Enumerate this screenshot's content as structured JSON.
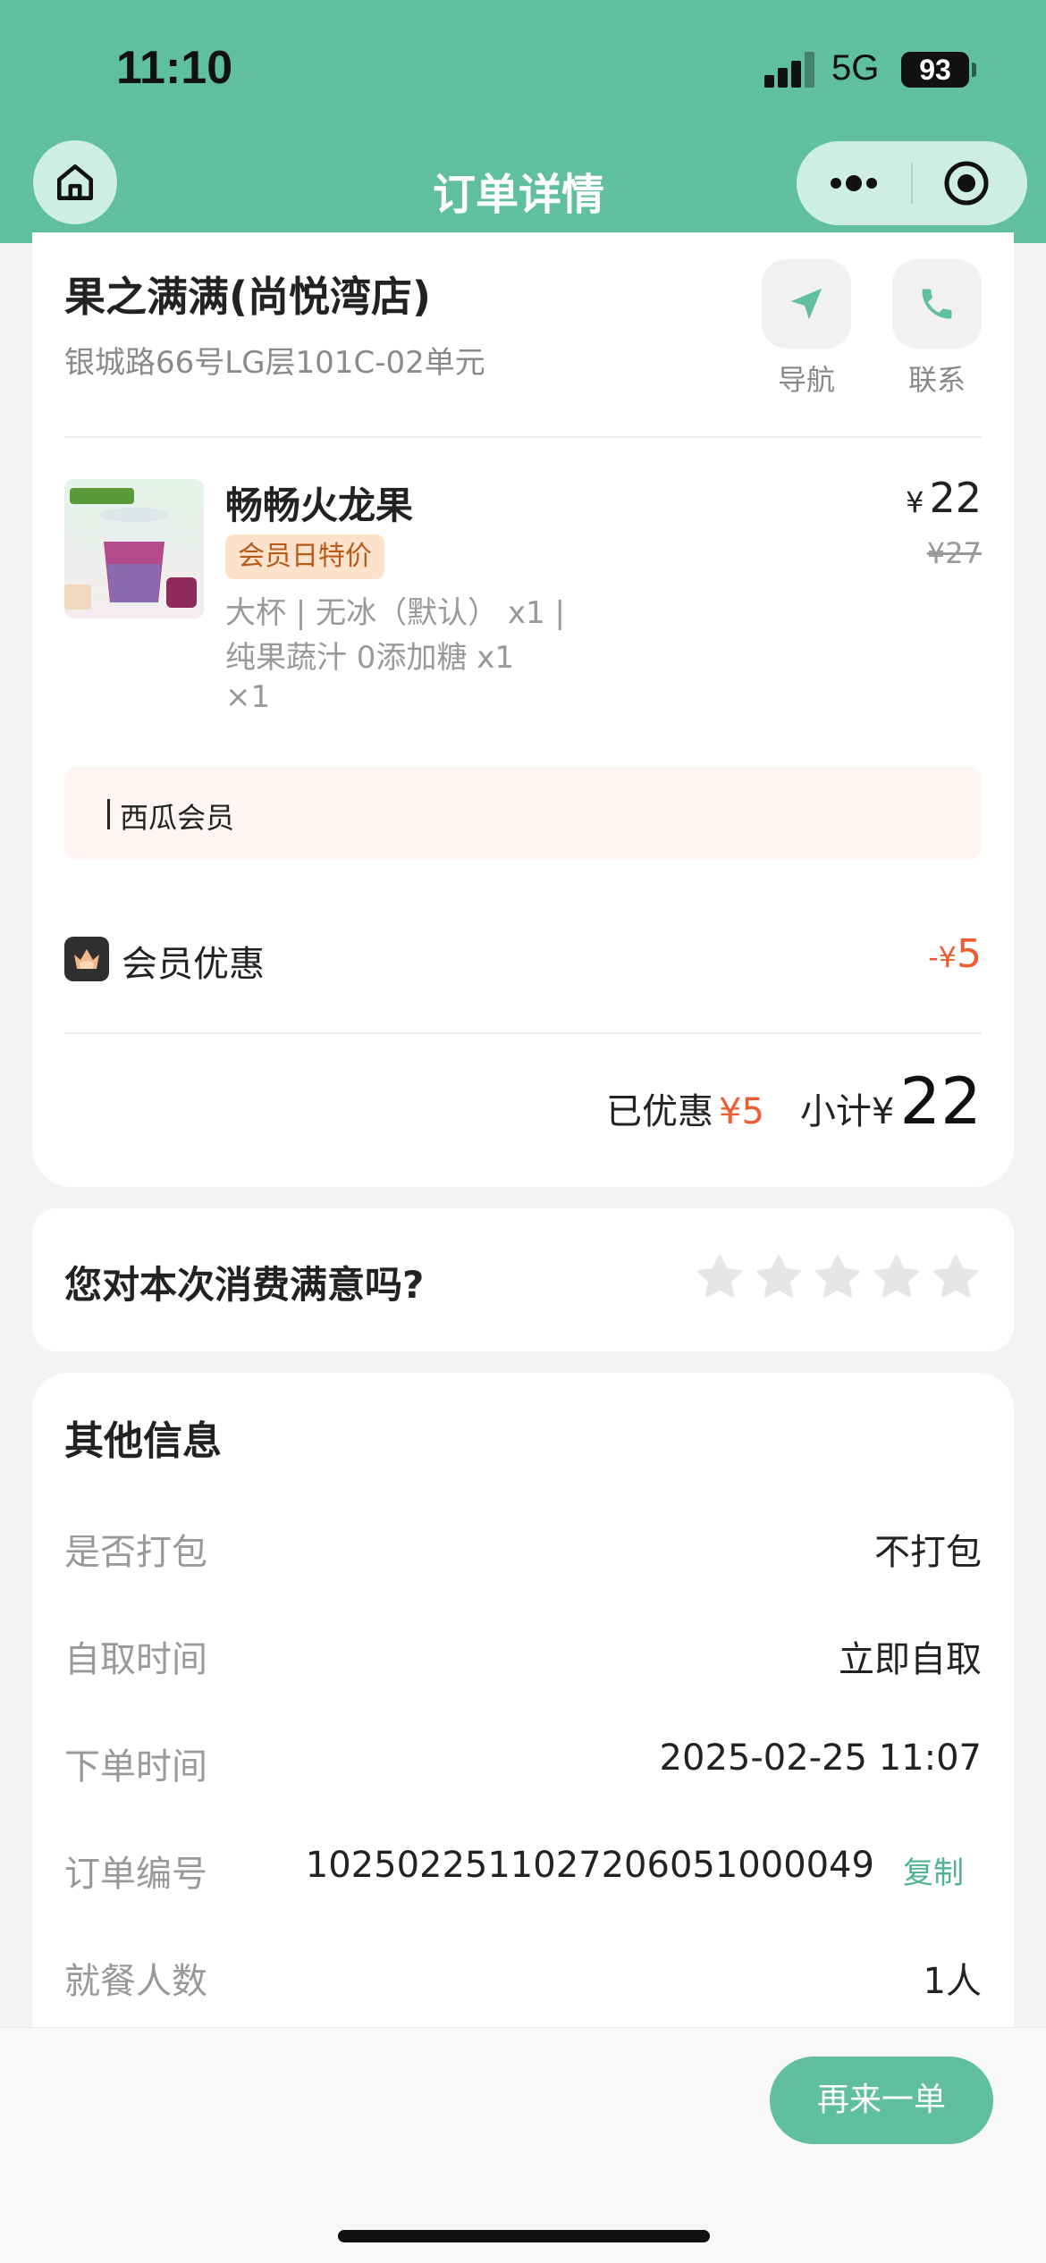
{
  "status_bar": {
    "time": "11:10",
    "network": "5G",
    "battery": "93"
  },
  "nav": {
    "title": "订单详情"
  },
  "store": {
    "name": "果之满满(尚悦湾店)",
    "address": "银城路66号LG层101C-02单元",
    "nav_label": "导航",
    "contact_label": "联系"
  },
  "product": {
    "name": "畅畅火龙果",
    "tag": "会员日特价",
    "spec_line1": "大杯 | 无冰（默认） x1 |",
    "spec_line2": "纯果蔬汁 0添加糖 x1",
    "qty": "×1",
    "price_symbol": "¥",
    "price": "22",
    "original_price": "¥27"
  },
  "member_box": {
    "label": "西瓜会员"
  },
  "discount": {
    "label": "会员优惠",
    "symbol_minus": "-¥",
    "amount": "5"
  },
  "subtotal": {
    "saved_label": "已优惠",
    "saved_amount": "¥5",
    "label": "小计",
    "symbol": "¥",
    "amount": "22"
  },
  "rating": {
    "question": "您对本次消费满意吗?",
    "stars": 5,
    "selected": 0
  },
  "info": {
    "title": "其他信息",
    "rows": [
      {
        "label": "是否打包",
        "value": "不打包"
      },
      {
        "label": "自取时间",
        "value": "立即自取"
      },
      {
        "label": "下单时间",
        "value": "2025-02-25 11:07"
      },
      {
        "label": "订单编号",
        "value": "1025022511027206051000049",
        "action": "复制"
      },
      {
        "label": "就餐人数",
        "value": "1人"
      }
    ]
  },
  "footer": {
    "reorder_label": "再来一单"
  },
  "colors": {
    "brand": "#5fbf9f",
    "accent_red": "#ef5b32",
    "copy_link": "#4db48f"
  }
}
